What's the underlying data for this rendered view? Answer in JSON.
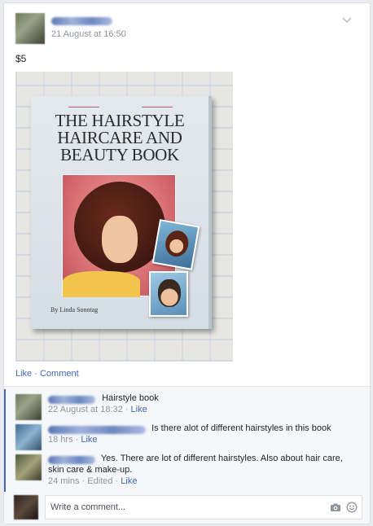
{
  "post": {
    "timestamp": "21 August at 16:50",
    "text": "$5",
    "photo": {
      "book_title_line1": "THE HAIRSTYLE",
      "book_title_line2": "HAIRCARE AND",
      "book_title_line3": "BEAUTY BOOK",
      "book_author": "By Linda Sonntag"
    },
    "actions": {
      "like": "Like",
      "separator": " · ",
      "comment": "Comment"
    }
  },
  "comments": [
    {
      "text": "Hairstyle book",
      "time": "22 August at 18:32",
      "sep": " · ",
      "like": "Like"
    },
    {
      "text": "Is there alot of different hairstyles in this book",
      "time": "18 hrs",
      "sep": " · ",
      "like": "Like"
    },
    {
      "text": "Yes. There are lot of different hairstyles. Also about hair care, skin care & make-up.",
      "time": "24 mins",
      "edited": " · Edited · ",
      "like": "Like"
    }
  ],
  "composer": {
    "placeholder": "Write a comment..."
  },
  "colors": {
    "link": "#4267b2",
    "meta": "#90949c",
    "accent_bar": "#4267b2"
  },
  "icons": {
    "menu": "chevron-down-icon",
    "photo": "camera-icon",
    "sticker": "smiley-icon"
  }
}
